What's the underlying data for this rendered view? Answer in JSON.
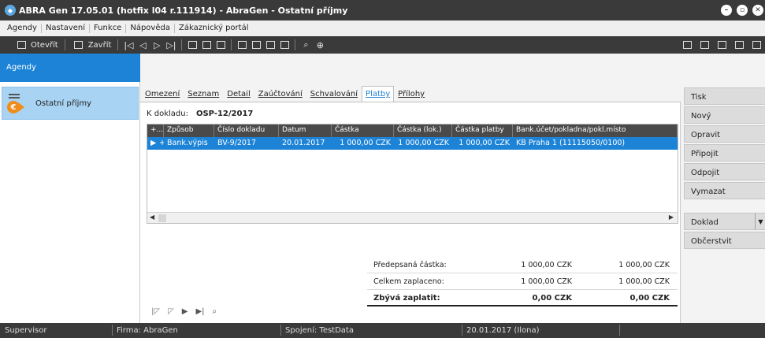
{
  "window": {
    "title": "ABRA Gen 17.05.01 (hotfix l04 r.111914)  - AbraGen - Ostatní příjmy"
  },
  "menu": [
    "Agendy",
    "Nastavení",
    "Funkce",
    "Nápověda",
    "Zákaznický portál"
  ],
  "toolbar": {
    "open_label": "Otevřít",
    "close_label": "Zavřít"
  },
  "sidebar": {
    "header": "Agendy",
    "items": [
      {
        "label": "Ostatní příjmy"
      }
    ]
  },
  "tabs": [
    "Omezení",
    "Seznam",
    "Detail",
    "Zaúčtování",
    "Schvalování",
    "Platby",
    "Přílohy"
  ],
  "active_tab": "Platby",
  "document": {
    "label": "K dokladu:",
    "value": "OSP-12/2017"
  },
  "grid": {
    "columns": [
      "+...",
      "Způsob",
      "Číslo dokladu",
      "Datum",
      "Částka",
      "Částka (lok.)",
      "Částka platby",
      "Bank.účet/pokladna/pokl.místo"
    ],
    "rows": [
      {
        "marker": "▶",
        "plus": "+",
        "zpusob": "Bank.výpis",
        "cislo": "BV-9/2017",
        "datum": "20.01.2017",
        "castka": "1 000,00 CZK",
        "castka_lok": "1 000,00 CZK",
        "castka_platby": "1 000,00 CZK",
        "ucet": "KB Praha 1 (11115050/0100)"
      }
    ]
  },
  "summary": {
    "rows": [
      {
        "label": "Předepsaná částka:",
        "v1": "1 000,00 CZK",
        "v2": "1 000,00 CZK"
      },
      {
        "label": "Celkem zaplaceno:",
        "v1": "1 000,00 CZK",
        "v2": "1 000,00 CZK"
      },
      {
        "label": "Zbývá zaplatit:",
        "v1": "0,00 CZK",
        "v2": "0,00 CZK"
      }
    ]
  },
  "actions": [
    "Tisk",
    "Nový",
    "Opravit",
    "Připojit",
    "Odpojit",
    "Vymazat"
  ],
  "actions2": {
    "doklad": "Doklad",
    "refresh": "Občerstvit"
  },
  "status": {
    "user": "Supervisor",
    "firm": "Firma: AbraGen",
    "connection": "Spojení: TestData",
    "date": "20.01.2017 (Ilona)"
  },
  "colors": {
    "accent": "#1d83d6",
    "titlebar": "#3a3a3a",
    "agenda_selected": "#a8d3f3"
  }
}
